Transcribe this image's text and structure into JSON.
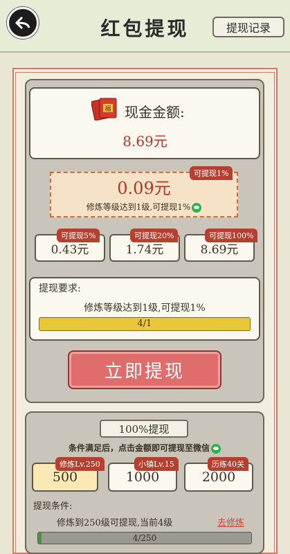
{
  "header": {
    "title": "红包提现",
    "record_label": "提现记录",
    "back_icon": "back-arrow-icon"
  },
  "cash": {
    "label": "现金金额:",
    "amount": "8.69元",
    "icon": "hongbao-icon"
  },
  "featured": {
    "tag": "可提现1%",
    "amount": "0.09元",
    "note": "修炼等级达到1级,可提现1%"
  },
  "options": [
    {
      "tag": "可提现5%",
      "amount": "0.43元"
    },
    {
      "tag": "可提现20%",
      "amount": "1.74元"
    },
    {
      "tag": "可提现100%",
      "amount": "8.69元"
    }
  ],
  "requirement": {
    "title": "提现要求:",
    "text": "修炼等级达到1级,可提现1%",
    "progress_text": "4/1",
    "progress": 1.0
  },
  "withdraw_button": "立即提现",
  "section2": {
    "title": "100%提现",
    "condition_line": "条件满足后，点击金额即可提现至微信",
    "levels": [
      {
        "tag": "修炼Lv.250",
        "amount": "500",
        "selected": true
      },
      {
        "tag": "小镇Lv.15",
        "amount": "1000",
        "selected": false
      },
      {
        "tag": "历练40关",
        "amount": "2000",
        "selected": false
      }
    ],
    "cond_label": "提现条件:",
    "cond_text": "修炼到250级可提现,当前4级",
    "go_link": "去修炼",
    "progress_text": "4/250",
    "progress": 0.016
  },
  "colors": {
    "accent_red": "#b2352a",
    "button_red": "#df6d6b",
    "progress_yellow": "#e8c838",
    "progress_green": "#3f9b34",
    "wechat_green": "#2bb24c"
  }
}
